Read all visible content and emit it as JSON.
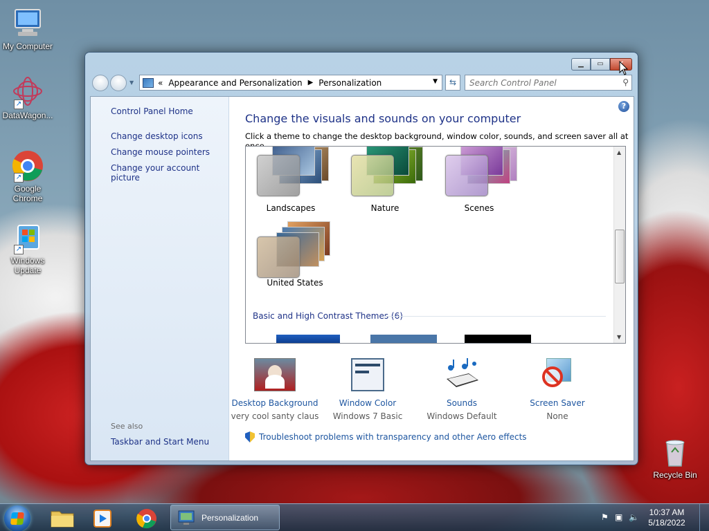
{
  "desktop": {
    "icons": [
      {
        "label": "My Computer"
      },
      {
        "label": "DataWagon..."
      },
      {
        "label": "Google Chrome"
      },
      {
        "label": "Windows Update"
      },
      {
        "label": "Recycle Bin"
      }
    ]
  },
  "window": {
    "breadcrumb": {
      "overflow": "«",
      "items": [
        "Appearance and Personalization",
        "Personalization"
      ]
    },
    "search_placeholder": "Search Control Panel",
    "help_glyph": "?",
    "left_links": [
      "Control Panel Home",
      "Change desktop icons",
      "Change mouse pointers",
      "Change your account picture"
    ],
    "see_also": "See also",
    "see_also_links": [
      "Taskbar and Start Menu"
    ],
    "title": "Change the visuals and sounds on your computer",
    "subtitle": "Click a theme to change the desktop background, window color, sounds, and screen saver all at once.",
    "themes": [
      {
        "label": "Landscapes"
      },
      {
        "label": "Nature"
      },
      {
        "label": "Scenes"
      },
      {
        "label": "United States"
      }
    ],
    "basic_group": "Basic and High Contrast Themes (6)",
    "settings": [
      {
        "link": "Desktop Background",
        "value": "very cool santy claus"
      },
      {
        "link": "Window Color",
        "value": "Windows 7 Basic"
      },
      {
        "link": "Sounds",
        "value": "Windows Default"
      },
      {
        "link": "Screen Saver",
        "value": "None"
      }
    ],
    "troubleshoot": "Troubleshoot problems with transparency and other Aero effects"
  },
  "taskbar": {
    "active_window": "Personalization",
    "time": "10:37 AM",
    "date": "5/18/2022"
  }
}
